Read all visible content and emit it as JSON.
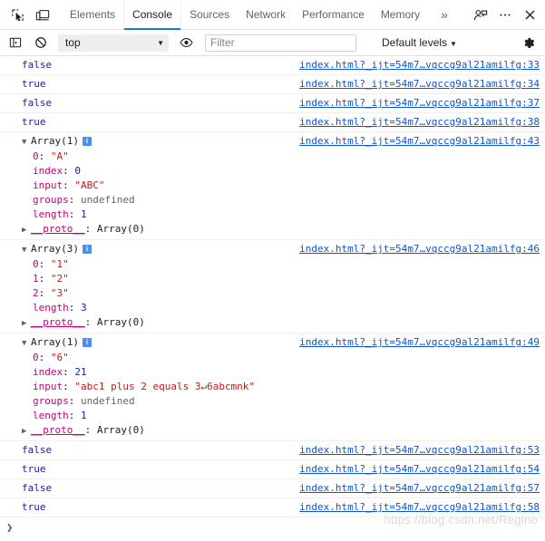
{
  "window": {
    "title": "Chrome DevTools - Console"
  },
  "tabbar": {
    "inspect_icon": "inspect-element-icon",
    "device_icon": "device-toolbar-icon",
    "tabs": [
      {
        "label": "Elements",
        "active": false
      },
      {
        "label": "Console",
        "active": true
      },
      {
        "label": "Sources",
        "active": false
      },
      {
        "label": "Network",
        "active": false
      },
      {
        "label": "Performance",
        "active": false
      },
      {
        "label": "Memory",
        "active": false
      }
    ],
    "more_tabs": "»",
    "feedback_icon": "feedback-person-icon",
    "menu_icon": "ellipsis-icon",
    "close_icon": "close-icon",
    "active_underline_color": "#1a73e8"
  },
  "toolbar": {
    "sidebar_icon": "console-sidebar-icon",
    "clear_icon": "clear-console-icon",
    "context": {
      "value": "top",
      "caret": "▼"
    },
    "eye_icon": "live-expression-eye-icon",
    "filter": {
      "value": "",
      "placeholder": "Filter"
    },
    "levels": {
      "label": "Default levels",
      "caret": "▼"
    },
    "settings_icon": "gear-icon"
  },
  "console": {
    "source_base": "index.html?_ijt=54m7…vqccg9al21amilfg",
    "messages": [
      {
        "kind": "value",
        "value": "false",
        "value_type": "bool",
        "source": "index.html?_ijt=54m7…vqccg9al21amilfg:33"
      },
      {
        "kind": "value",
        "value": "true",
        "value_type": "bool",
        "source": "index.html?_ijt=54m7…vqccg9al21amilfg:34"
      },
      {
        "kind": "value",
        "value": "false",
        "value_type": "bool",
        "source": "index.html?_ijt=54m7…vqccg9al21amilfg:37"
      },
      {
        "kind": "value",
        "value": "true",
        "value_type": "bool",
        "source": "index.html?_ijt=54m7…vqccg9al21amilfg:38"
      },
      {
        "kind": "object",
        "expanded": true,
        "triangle": "▼",
        "header": "Array(1)",
        "info_badge": "i",
        "source": "index.html?_ijt=54m7…vqccg9al21amilfg:43",
        "properties": [
          {
            "name": "0",
            "value": "\"A\"",
            "value_type": "string"
          },
          {
            "name": "index",
            "value": "0",
            "value_type": "number"
          },
          {
            "name": "input",
            "value": "\"ABC\"",
            "value_type": "string"
          },
          {
            "name": "groups",
            "value": "undefined",
            "value_type": "undefined"
          },
          {
            "name": "length",
            "value": "1",
            "value_type": "number"
          },
          {
            "name": "__proto__",
            "value": "Array(0)",
            "value_type": "object",
            "triangle": "▶"
          }
        ]
      },
      {
        "kind": "object",
        "expanded": true,
        "triangle": "▼",
        "header": "Array(3)",
        "info_badge": "i",
        "source": "index.html?_ijt=54m7…vqccg9al21amilfg:46",
        "properties": [
          {
            "name": "0",
            "value": "\"1\"",
            "value_type": "string"
          },
          {
            "name": "1",
            "value": "\"2\"",
            "value_type": "string"
          },
          {
            "name": "2",
            "value": "\"3\"",
            "value_type": "string"
          },
          {
            "name": "length",
            "value": "3",
            "value_type": "number"
          },
          {
            "name": "__proto__",
            "value": "Array(0)",
            "value_type": "object",
            "triangle": "▶"
          }
        ]
      },
      {
        "kind": "object",
        "expanded": true,
        "triangle": "▼",
        "header": "Array(1)",
        "info_badge": "i",
        "source": "index.html?_ijt=54m7…vqccg9al21amilfg:49",
        "properties": [
          {
            "name": "0",
            "value": "\"6\"",
            "value_type": "string"
          },
          {
            "name": "index",
            "value": "21",
            "value_type": "number"
          },
          {
            "name": "input",
            "value": "\"abc1 plus 2 equals 3↵6abcmnk\"",
            "value_type": "string"
          },
          {
            "name": "groups",
            "value": "undefined",
            "value_type": "undefined"
          },
          {
            "name": "length",
            "value": "1",
            "value_type": "number"
          },
          {
            "name": "__proto__",
            "value": "Array(0)",
            "value_type": "object",
            "triangle": "▶"
          }
        ]
      },
      {
        "kind": "value",
        "value": "false",
        "value_type": "bool",
        "source": "index.html?_ijt=54m7…vqccg9al21amilfg:53"
      },
      {
        "kind": "value",
        "value": "true",
        "value_type": "bool",
        "source": "index.html?_ijt=54m7…vqccg9al21amilfg:54"
      },
      {
        "kind": "value",
        "value": "false",
        "value_type": "bool",
        "source": "index.html?_ijt=54m7…vqccg9al21amilfg:57"
      },
      {
        "kind": "value",
        "value": "true",
        "value_type": "bool",
        "source": "index.html?_ijt=54m7…vqccg9al21amilfg:58"
      }
    ],
    "prompt_caret": "❯"
  },
  "watermark": {
    "text": "https://blog.csdn.net/Regino"
  }
}
